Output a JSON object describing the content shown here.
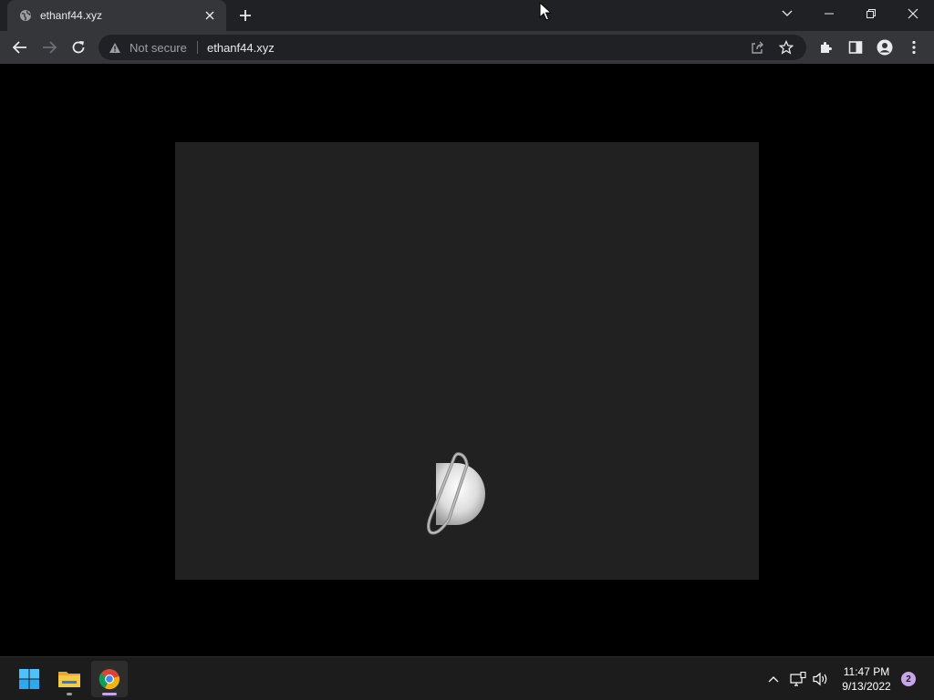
{
  "browser": {
    "tab": {
      "title": "ethanf44.xyz",
      "favicon": "globe-icon",
      "close_icon": "close-icon"
    },
    "new_tab_icon": "plus-icon",
    "tab_search_icon": "chevron-down-icon",
    "window_controls": [
      "minimize-icon",
      "restore-icon",
      "close-icon"
    ],
    "toolbar": {
      "back_icon": "back-arrow-icon",
      "forward_icon": "forward-arrow-icon",
      "reload_icon": "reload-icon",
      "security_label": "Not secure",
      "security_icon": "warning-triangle-icon",
      "url": "ethanf44.xyz",
      "share_icon": "share-icon",
      "bookmark_icon": "star-icon",
      "extensions_icon": "puzzle-icon",
      "side_panel_icon": "side-panel-icon",
      "profile_icon": "profile-icon",
      "menu_icon": "kebab-menu-icon"
    }
  },
  "page": {
    "canvas_bg": "#212121",
    "content": "planet-sprite"
  },
  "taskbar": {
    "apps": [
      {
        "name": "start",
        "icon": "windows-logo-icon"
      },
      {
        "name": "file-explorer",
        "icon": "folder-icon"
      },
      {
        "name": "chrome",
        "icon": "chrome-icon",
        "active": true
      }
    ],
    "tray": {
      "overflow_icon": "chevron-up-icon",
      "network_icon": "network-icon",
      "volume_icon": "volume-icon",
      "time": "11:47 PM",
      "date": "9/13/2022",
      "notification_count": "2"
    }
  },
  "colors": {
    "tabstrip": "#202124",
    "toolbar": "#35363a",
    "omnibox": "#202124",
    "taskbar": "#1c1c1c",
    "accent_badge": "#c8a5e8"
  }
}
